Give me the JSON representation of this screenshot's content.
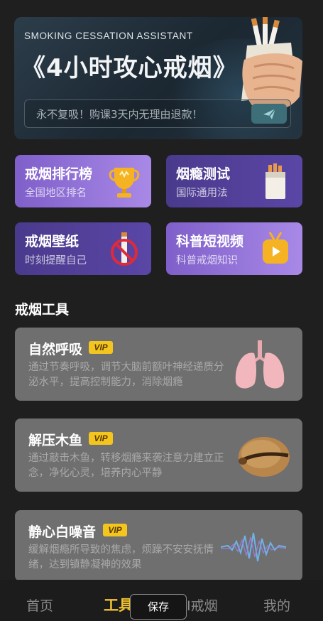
{
  "hero": {
    "subtitle": "SMOKING CESSATION ASSISTANT",
    "title": "《4小时攻心戒烟》",
    "search_text": "永不复吸！购课3天内无理由退款！",
    "send_icon": "paper-plane-icon"
  },
  "cards": [
    {
      "title": "戒烟排行榜",
      "subtitle": "全国地区排名",
      "icon": "trophy-icon"
    },
    {
      "title": "烟瘾测试",
      "subtitle": "国际通用法",
      "icon": "cigarette-pack-icon"
    },
    {
      "title": "戒烟壁纸",
      "subtitle": "时刻提醒自己",
      "icon": "no-smoking-icon"
    },
    {
      "title": "科普短视频",
      "subtitle": "科普戒烟知识",
      "icon": "video-play-icon"
    }
  ],
  "section_title": "戒烟工具",
  "tools": [
    {
      "name": "自然呼吸",
      "badge": "VIP",
      "desc": "通过节奏呼吸，调节大脑前额叶神经递质分泌水平，提高控制能力，消除烟瘾",
      "icon": "lungs-icon"
    },
    {
      "name": "解压木鱼",
      "badge": "VIP",
      "desc": "通过敲击木鱼，转移烟瘾来袭注意力建立正念，净化心灵，培养内心平静",
      "icon": "wooden-fish-icon"
    },
    {
      "name": "静心白噪音",
      "badge": "VIP",
      "desc": "缓解烟瘾所导致的焦虑，烦躁不安安抚情绪，达到镇静凝神的效果",
      "icon": "sound-wave-icon"
    }
  ],
  "nav": {
    "items": [
      "首页",
      "工具",
      "AI戒烟",
      "我的"
    ],
    "active": "工具"
  },
  "save_label": "保存",
  "colors": {
    "accent": "#f1c232",
    "purple_light": "#a889e7",
    "purple_dark": "#4a3a8c"
  }
}
